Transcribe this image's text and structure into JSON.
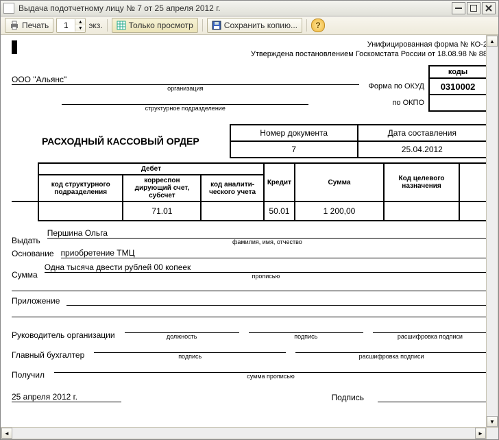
{
  "window": {
    "title": "Выдача подотчетному лицу № 7 от 25 апреля 2012 г."
  },
  "toolbar": {
    "print_label": "Печать",
    "copies_value": "1",
    "ekz_label": "экз.",
    "view_only_label": "Только просмотр",
    "save_copy_label": "Сохранить копию...",
    "help_label": "?"
  },
  "form": {
    "form_name": "Унифицированная форма № КО-2",
    "approved": "Утверждена постановлением Госкомстата России от 18.08.98 № 88",
    "codes_header": "коды",
    "okud_label": "Форма по ОКУД",
    "okud_value": "0310002",
    "okpo_label": "по ОКПО",
    "okpo_value": "",
    "org_value": "ООО \"Альянс\"",
    "org_caption": "организация",
    "subunit_value": "",
    "subunit_caption": "структурное подразделение",
    "doc_title": "РАСХОДНЫЙ КАССОВЫЙ ОРДЕР",
    "doc_no_label": "Номер документа",
    "doc_no_value": "7",
    "doc_date_label": "Дата составления",
    "doc_date_value": "25.04.2012"
  },
  "table": {
    "debet_label": "Дебет",
    "col_struct": "код структурного подразделения",
    "col_corr": "корреспон дирующий счет, субсчет",
    "col_anal": "код аналити- ческого учета",
    "col_credit": "Кредит",
    "col_sum": "Сумма",
    "col_purpose": "Код целевого назначения",
    "row": {
      "struct": "",
      "corr": "71.01",
      "anal": "",
      "credit": "50.01",
      "sum": "1 200,00",
      "purpose": "",
      "blank": ""
    }
  },
  "fields": {
    "issue_label": "Выдать",
    "issue_value": "Першина Ольга",
    "issue_caption": "фамилия, имя, отчество",
    "basis_label": "Основание",
    "basis_value": "приобретение ТМЦ",
    "sum_label": "Сумма",
    "sum_value": "Одна тысяча двести рублей 00 копеек",
    "sum_caption": "прописью",
    "attach_label": "Приложение"
  },
  "sign": {
    "head_label": "Руководитель организации",
    "position_caption": "должность",
    "sign_caption": "подпись",
    "decode_caption": "расшифровка подписи",
    "accountant_label": "Главный бухгалтер",
    "received_label": "Получил",
    "sum_words_caption": "сумма прописью",
    "date_value": "25 апреля 2012 г.",
    "sign_label": "Подпись"
  }
}
